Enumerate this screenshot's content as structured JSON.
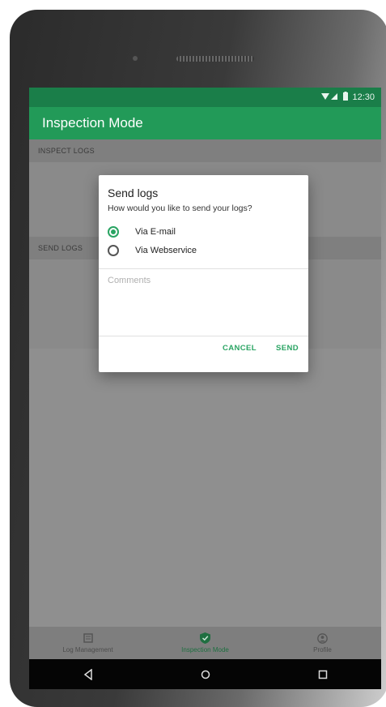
{
  "status_bar": {
    "time": "12:30",
    "signal_icon": "wifi-signal-icon",
    "battery_icon": "battery-icon"
  },
  "app_bar": {
    "title": "Inspection Mode"
  },
  "sections": [
    {
      "header": "INSPECT LOGS"
    },
    {
      "header": "SEND LOGS"
    }
  ],
  "dialog": {
    "title": "Send logs",
    "subtitle": "How would you like to send your logs?",
    "options": [
      {
        "label": "Via E-mail",
        "checked": true
      },
      {
        "label": "Via Webservice",
        "checked": false
      }
    ],
    "comments_placeholder": "Comments",
    "cancel_label": "CANCEL",
    "send_label": "SEND"
  },
  "bottom_nav": {
    "items": [
      {
        "label": "Log Management",
        "icon": "log-management-icon",
        "active": false
      },
      {
        "label": "Inspection Mode",
        "icon": "shield-check-icon",
        "active": true
      },
      {
        "label": "Profile",
        "icon": "profile-icon",
        "active": false
      }
    ]
  },
  "system_nav": {
    "back_icon": "back-icon",
    "home_icon": "home-icon",
    "recents_icon": "recents-icon"
  },
  "colors": {
    "primary": "#229a58",
    "primary_dark": "#1a7e49",
    "accent": "#2aa463",
    "scrim": "#8f8f8f"
  }
}
